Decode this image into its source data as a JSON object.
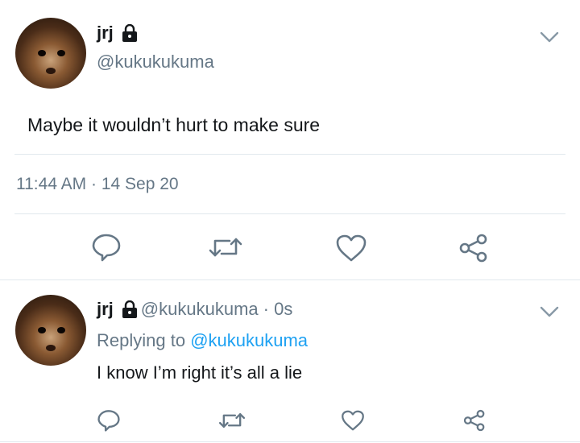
{
  "tweet": {
    "display_name": "jrj",
    "handle": "@kukukukuma",
    "text": "Maybe it wouldn’t hurt to make sure",
    "time": "11:44 AM · 14 Sep 20"
  },
  "reply": {
    "display_name": "jrj",
    "handle": "@kukukukuma",
    "time_ago": "· 0s",
    "replying_prefix": "Replying to",
    "replying_handle": "@kukukukuma",
    "text": "I know I’m right it’s all a lie"
  },
  "icons": {
    "lock": "lock-icon",
    "chevron": "chevron-down-icon",
    "reply": "comment-icon",
    "retweet": "retweet-icon",
    "like": "heart-icon",
    "share": "share-icon"
  },
  "colors": {
    "text": "#14171a",
    "muted": "#657786",
    "link": "#1da1f2",
    "divider": "#e1e8ed"
  }
}
